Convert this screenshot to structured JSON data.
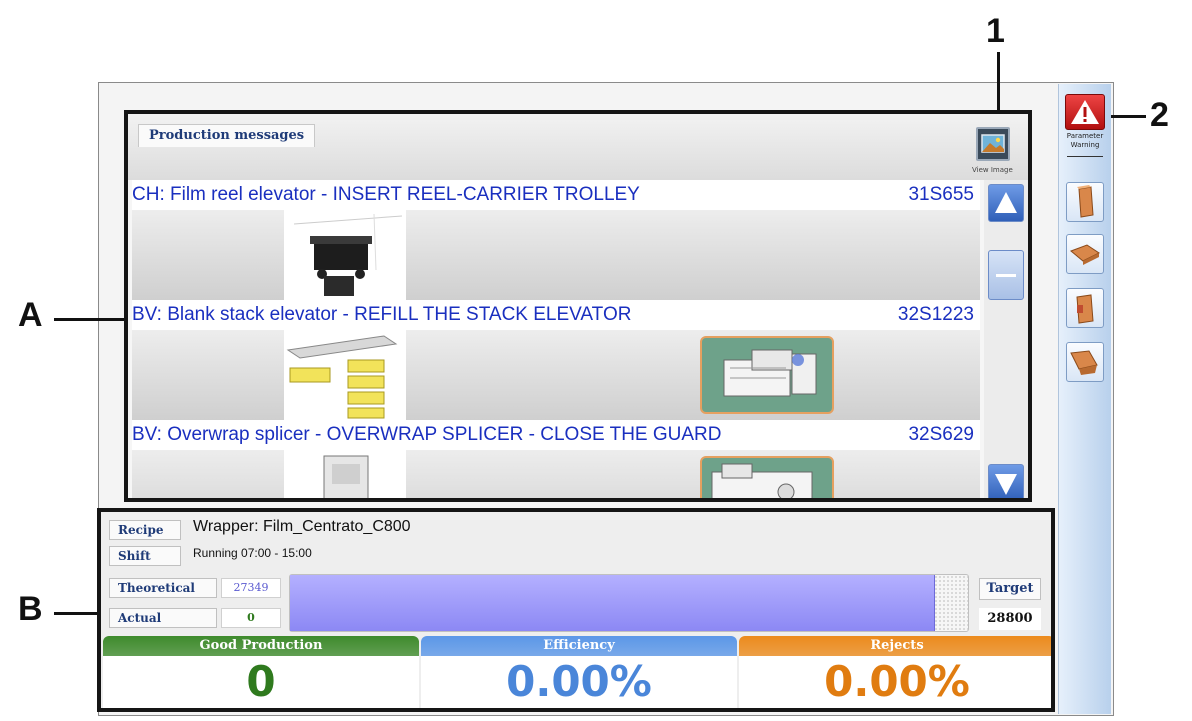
{
  "annotations": {
    "one": "1",
    "two": "2",
    "a": "A",
    "b": "B"
  },
  "messages_panel": {
    "tab_label": "Production messages",
    "view_image_label": "View Image",
    "items": [
      {
        "text": "CH: Film reel elevator - INSERT REEL-CARRIER TROLLEY",
        "code": "31S655"
      },
      {
        "text": "BV: Blank stack elevator - REFILL THE STACK ELEVATOR",
        "code": "32S1223"
      },
      {
        "text": "BV: Overwrap splicer - OVERWRAP SPLICER - CLOSE THE GUARD",
        "code": "32S629"
      }
    ]
  },
  "production": {
    "recipe_label": "Recipe",
    "recipe_value": "Wrapper: Film_Centrato_C800",
    "shift_label": "Shift",
    "shift_value": "Running 07:00 - 15:00",
    "theoretical_label": "Theoretical",
    "theoretical_value": "27349",
    "actual_label": "Actual",
    "actual_value": "0",
    "target_label": "Target",
    "target_value": "28800",
    "theoretical_fraction": 0.95
  },
  "kpis": {
    "good_production": {
      "label": "Good Production",
      "value": "0",
      "head_color": "#3e8a2c",
      "value_color": "#2f7a1e"
    },
    "efficiency": {
      "label": "Efficiency",
      "value": "0.00%",
      "head_color": "#5b97e8",
      "value_color": "#4a86d9"
    },
    "rejects": {
      "label": "Rejects",
      "value": "0.00%",
      "head_color": "#ec8a1c",
      "value_color": "#e07c10"
    }
  },
  "sidebar": {
    "warning_label_line1": "Parameter",
    "warning_label_line2": "Warning",
    "buttons": [
      "package-upright-icon",
      "package-flat-icon",
      "package-open-icon",
      "package-tilted-icon"
    ]
  }
}
